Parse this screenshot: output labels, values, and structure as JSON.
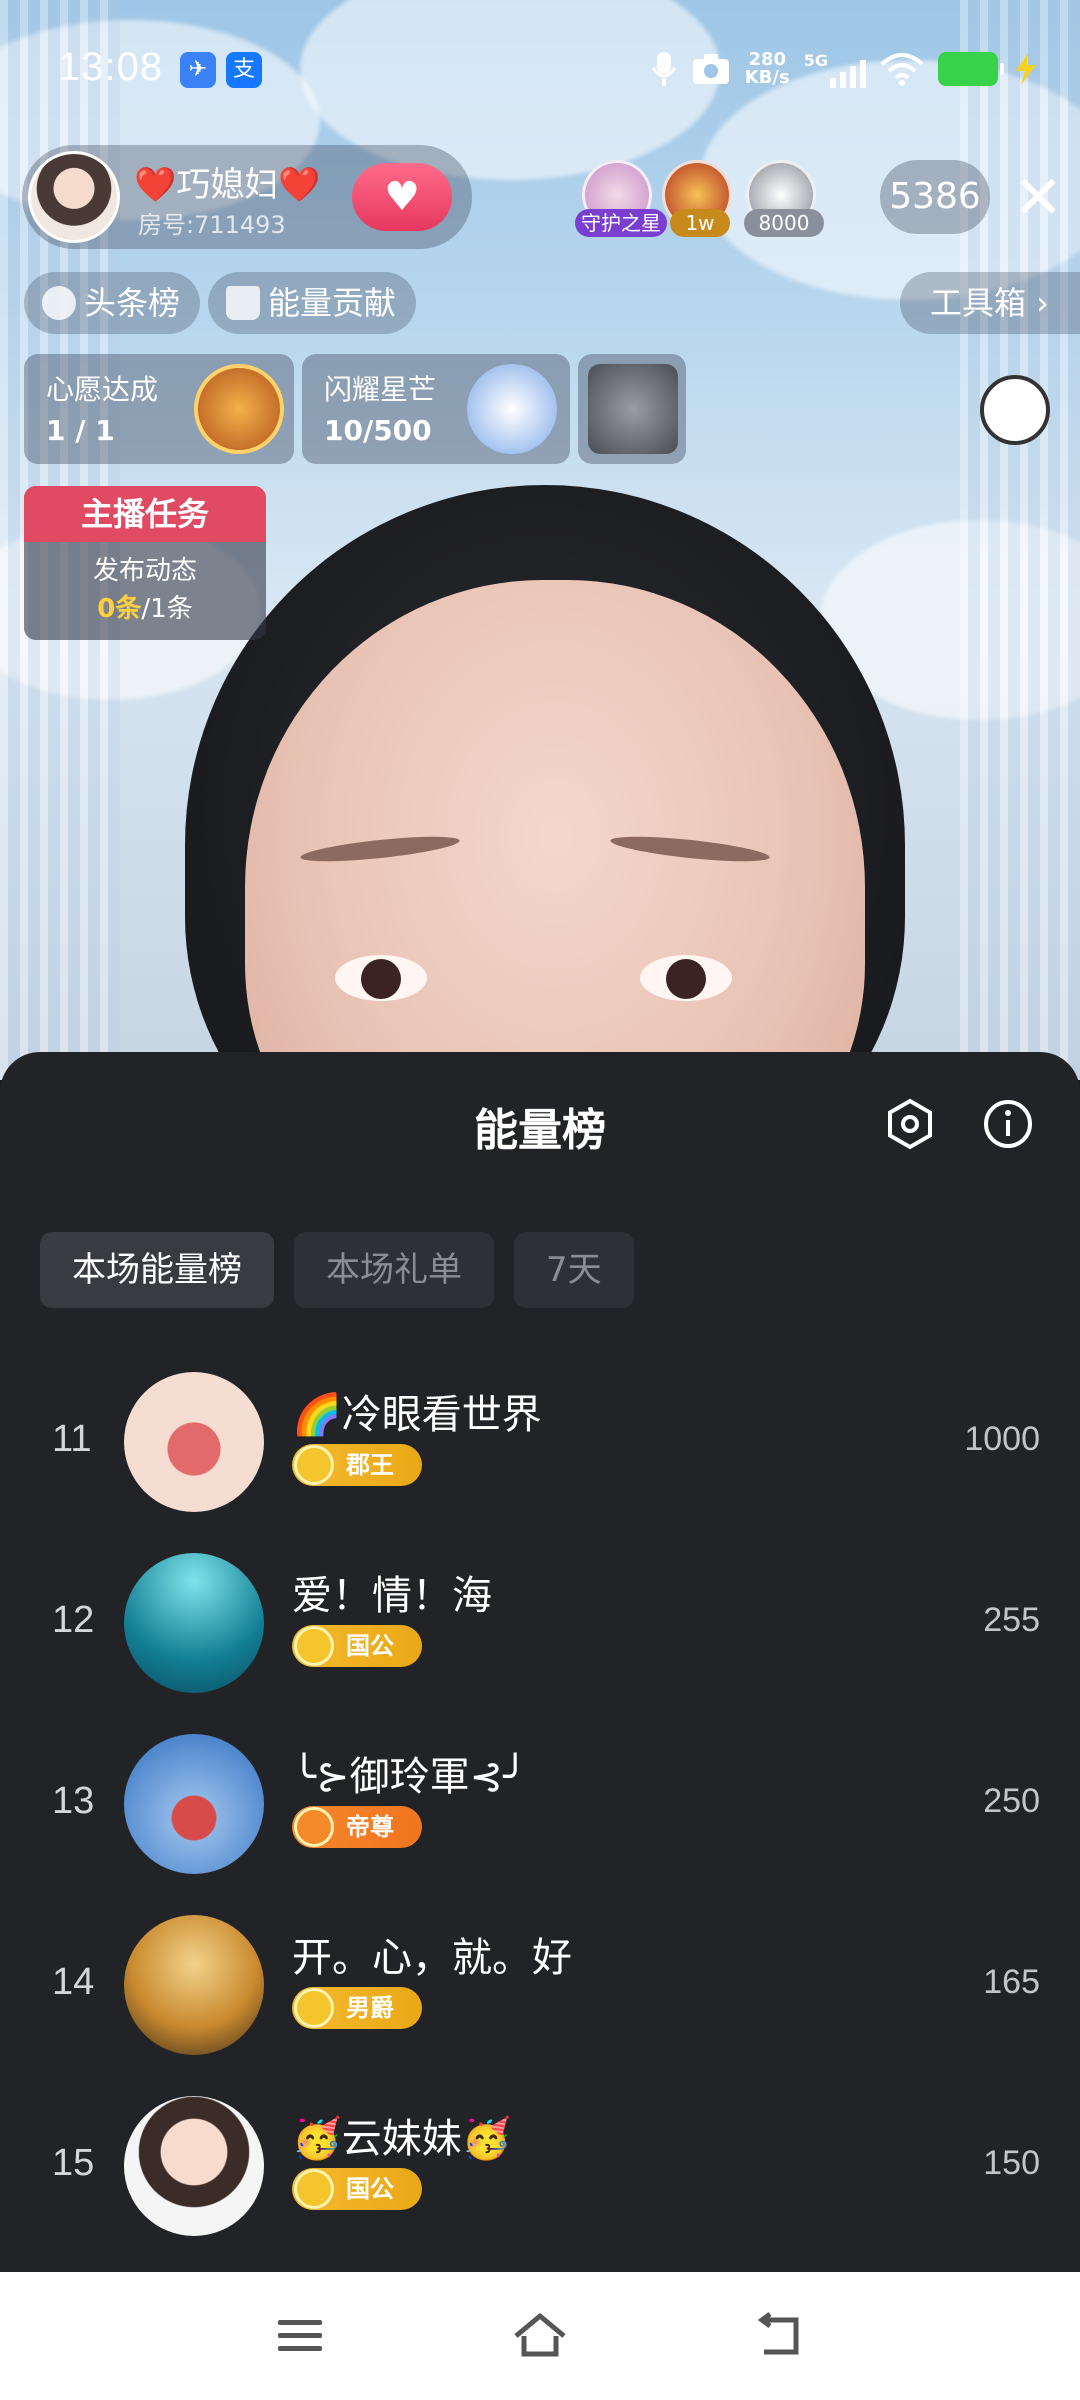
{
  "status_bar": {
    "time": "13:08",
    "network_speed": "280",
    "network_unit": "KB/s",
    "network_type": "5G",
    "app_icon_1": "paper-plane-icon",
    "app_icon_2": "alipay-icon",
    "app_icon_2_glyph": "支"
  },
  "host": {
    "name": "❤️巧媳妇❤️",
    "room_id": "房号:711493"
  },
  "top_viewers": [
    {
      "badge": "守护之星",
      "badge_color": "#7a3fd1"
    },
    {
      "badge": "1w",
      "badge_color": "#c88a1a"
    },
    {
      "badge": "8000",
      "badge_color": "#8a8f9c"
    }
  ],
  "viewer_count": "5386",
  "rank_pills": {
    "headline": "头条榜",
    "energy": "能量贡献"
  },
  "toolbox_label": "工具箱 ›",
  "goal_cards": [
    {
      "title": "心愿达成",
      "value": "1 / 1"
    },
    {
      "title": "闪耀星芒",
      "value": "10/500"
    }
  ],
  "host_task": {
    "title": "主播任务",
    "desc": "发布动态",
    "progress_done": "0条",
    "progress_total": "/1条"
  },
  "sheet": {
    "title": "能量榜",
    "tabs": [
      "本场能量榜",
      "本场礼单",
      "7天"
    ],
    "active_tab": 0,
    "rows": [
      {
        "rank": "11",
        "name": "🌈冷眼看世界",
        "level": "郡王",
        "level_color": "#e9a816",
        "score": "1000"
      },
      {
        "rank": "12",
        "name": "爱！情！海",
        "level": "国公",
        "level_color": "#e9a816",
        "score": "255"
      },
      {
        "rank": "13",
        "name": "╰⊱御玲軍⊰╯",
        "level": "帝尊",
        "level_color": "#f0751f",
        "score": "250"
      },
      {
        "rank": "14",
        "name": "开。心，就。好",
        "level": "男爵",
        "level_color": "#e9a816",
        "score": "165"
      },
      {
        "rank": "15",
        "name": "🥳云妹妹🥳",
        "level": "国公",
        "level_color": "#e9a816",
        "score": "150"
      }
    ]
  },
  "nav": {
    "menu": "menu-icon",
    "home": "home-icon",
    "back": "back-icon"
  }
}
